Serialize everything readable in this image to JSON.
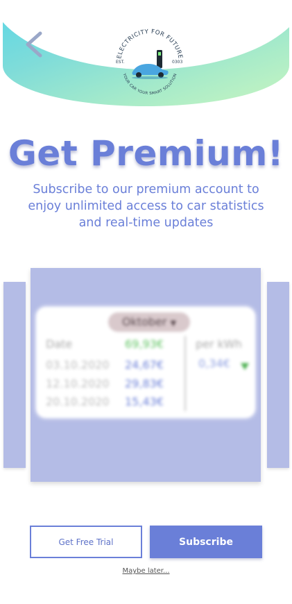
{
  "header": {
    "logo": {
      "top_text": "ELECTRICITY FOR FUTURE",
      "bottom_text": "YOUR CAR YOUR SMART SOLUTION",
      "est_label": "EST.",
      "est_year": "0303"
    }
  },
  "premium": {
    "title": "Get Premium!",
    "subtitle": "Subscribe to our premium account to enjoy unlimited access to car statistics and real-time updates"
  },
  "preview": {
    "month": "Oktober",
    "headers": {
      "date": "Date",
      "total": "69,93€",
      "per_kwh": "per kWh"
    },
    "rows": [
      {
        "date": "03.10.2020",
        "amount": "24,67€"
      },
      {
        "date": "12.10.2020",
        "amount": "29,83€"
      },
      {
        "date": "20.10.2020",
        "amount": "15,43€"
      }
    ],
    "per_kwh_value": "0,34€"
  },
  "buttons": {
    "trial": "Get Free Trial",
    "subscribe": "Subscribe",
    "maybe_later": "Maybe later..."
  },
  "colors": {
    "accent": "#6a7fd8",
    "panel": "#b4bce6",
    "positive": "#5fc462"
  }
}
